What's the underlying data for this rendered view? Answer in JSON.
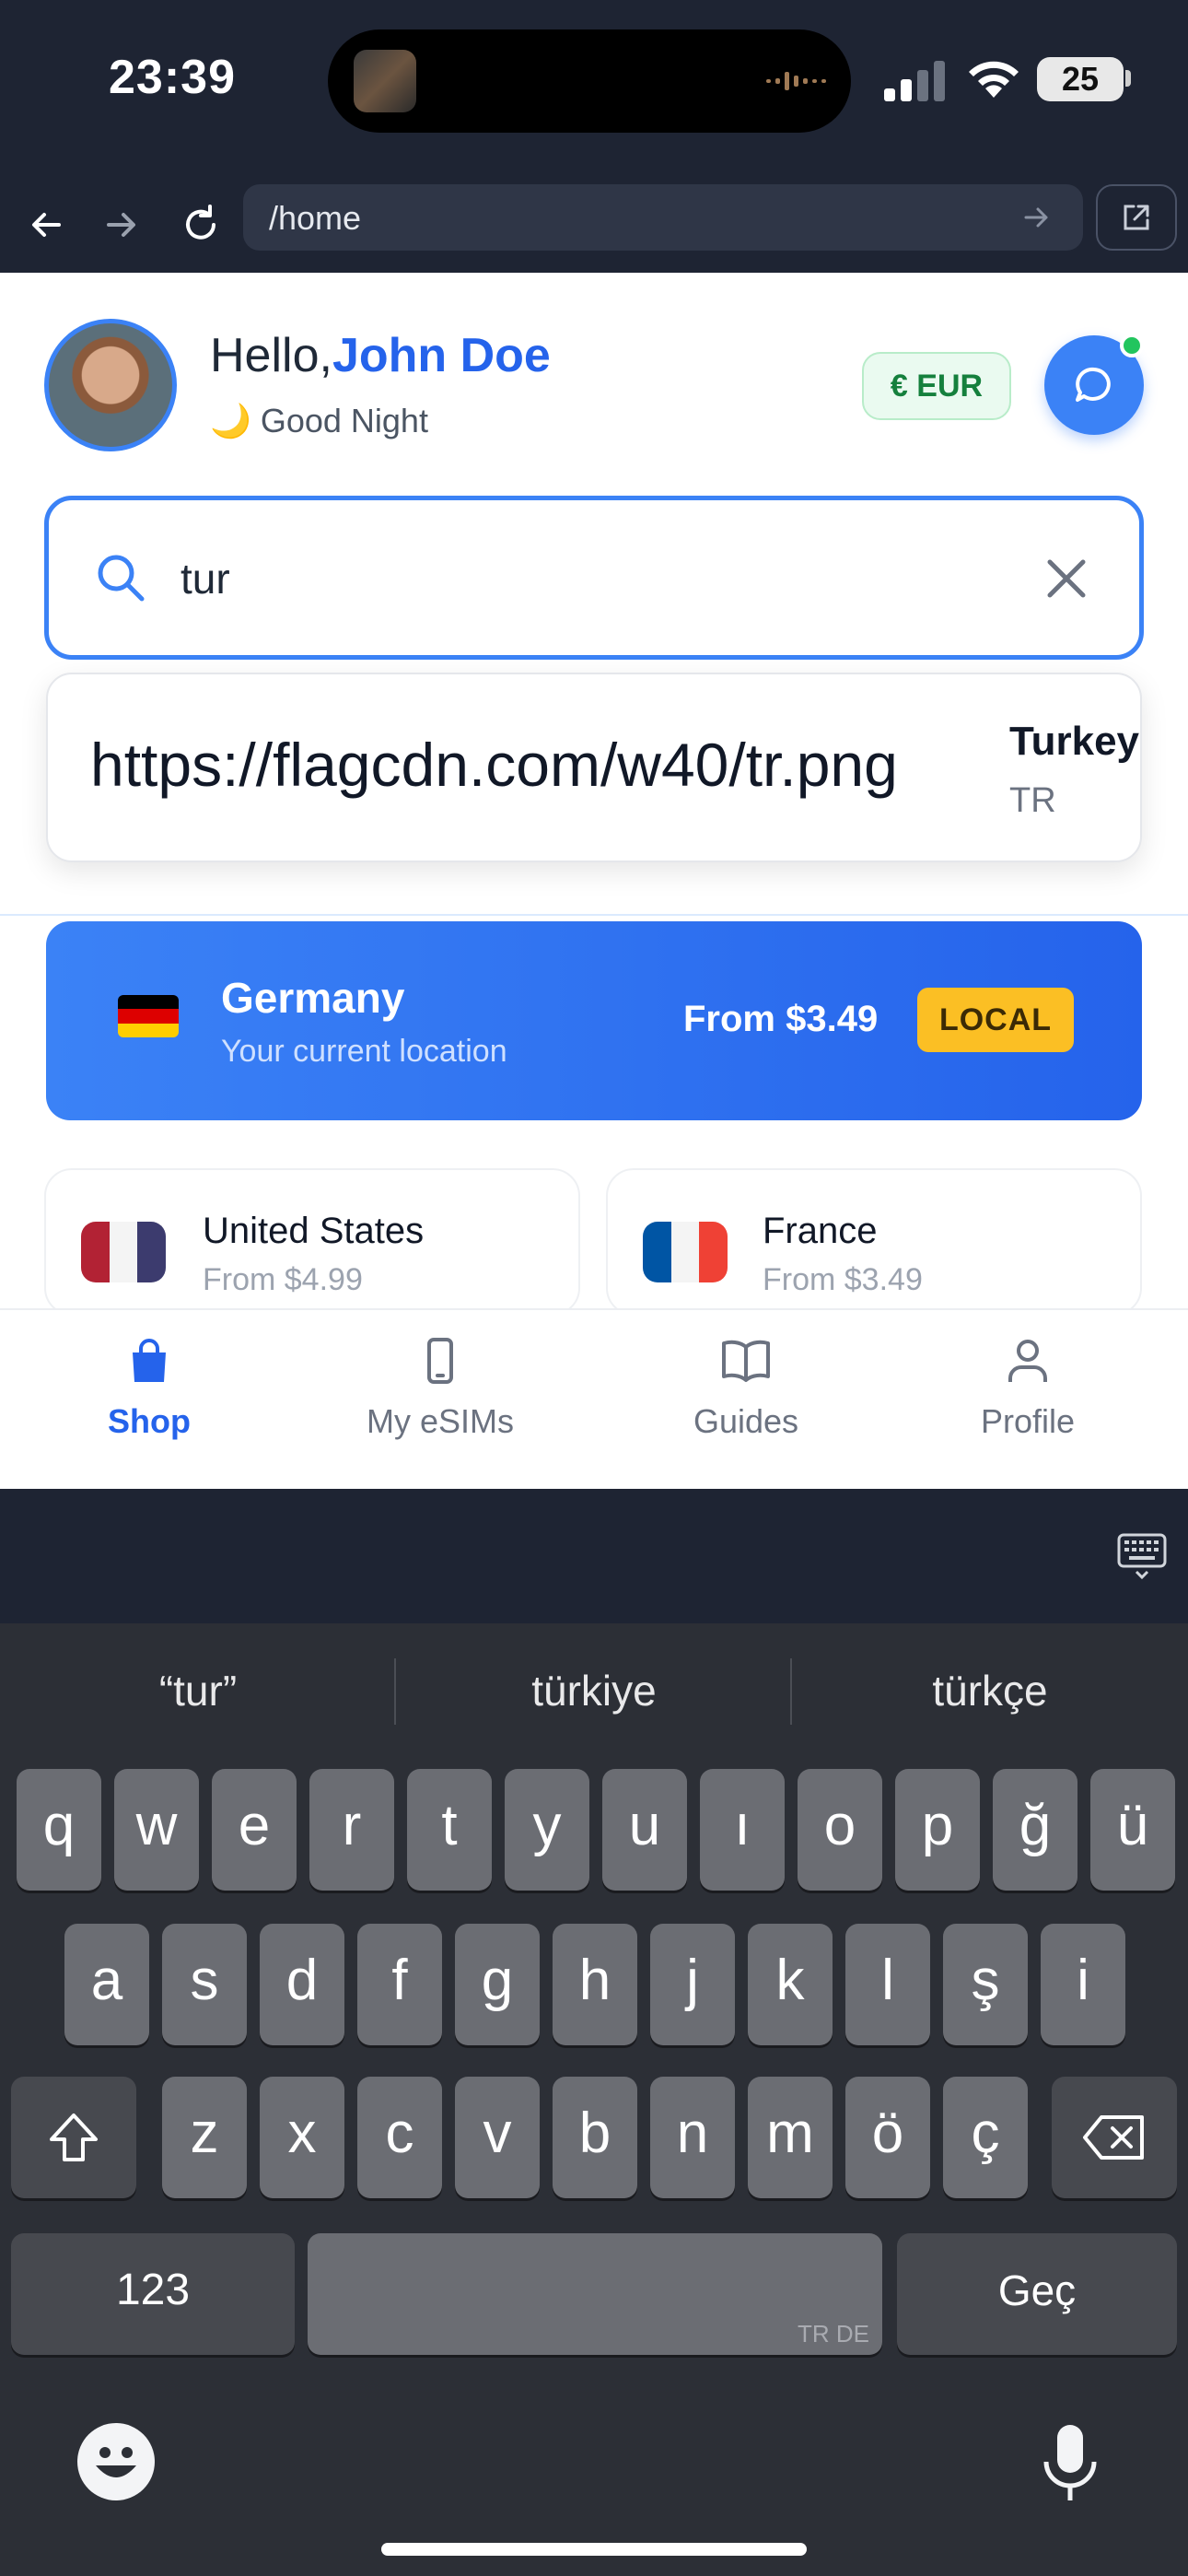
{
  "status_bar": {
    "time": "23:39",
    "battery": "25"
  },
  "browser": {
    "url": "/home"
  },
  "header": {
    "greeting_prefix": "Hello,",
    "user_name": "John Doe",
    "greeting_emoji": "🌙",
    "greeting_text": "Good Night",
    "currency_label": "€ EUR",
    "chat_badge_color": "#22c55e"
  },
  "search": {
    "value": "tur",
    "results": [
      {
        "flag_alt": "https://flagcdn.com/w40/tr.png",
        "country": "Turkey",
        "code": "TR"
      }
    ]
  },
  "current_location": {
    "country": "Germany",
    "subtitle": "Your current location",
    "price": "From $3.49",
    "badge": "LOCAL"
  },
  "countries": [
    {
      "name": "United States",
      "price": "From $4.99"
    },
    {
      "name": "France",
      "price": "From $3.49"
    }
  ],
  "tabs": [
    {
      "label": "Shop",
      "icon": "shopping-bag-icon",
      "active": true
    },
    {
      "label": "My eSIMs",
      "icon": "phone-icon",
      "active": false
    },
    {
      "label": "Guides",
      "icon": "book-icon",
      "active": false
    },
    {
      "label": "Profile",
      "icon": "user-icon",
      "active": false
    }
  ],
  "keyboard": {
    "suggestions": [
      "“tur”",
      "türkiye",
      "türkçe"
    ],
    "row1": [
      "q",
      "w",
      "e",
      "r",
      "t",
      "y",
      "u",
      "ı",
      "o",
      "p",
      "ğ",
      "ü"
    ],
    "row2": [
      "a",
      "s",
      "d",
      "f",
      "g",
      "h",
      "j",
      "k",
      "l",
      "ş",
      "i"
    ],
    "row3": [
      "z",
      "x",
      "c",
      "v",
      "b",
      "n",
      "m",
      "ö",
      "ç"
    ],
    "numbers_key": "123",
    "space_hint": "TR DE",
    "return_key": "Geç"
  },
  "colors": {
    "accent": "#3b82f6",
    "currency_green": "#15803d",
    "local_badge": "#fbbf24"
  }
}
